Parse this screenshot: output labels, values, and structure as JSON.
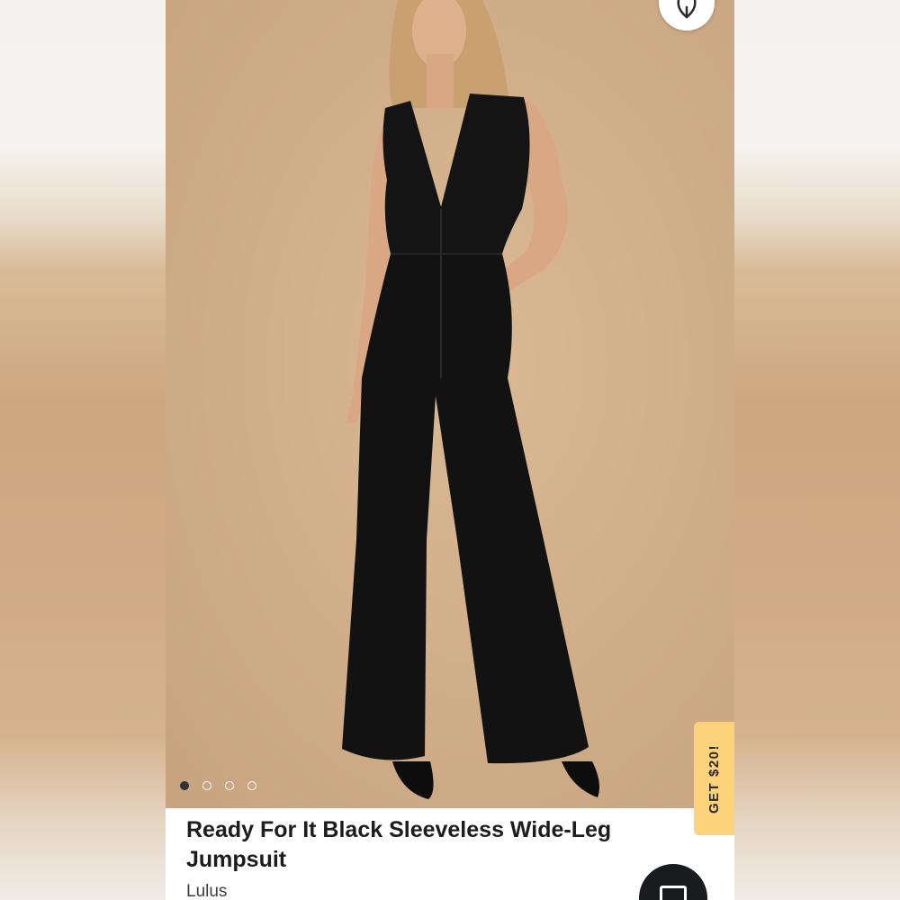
{
  "listing": {
    "title": "Ready For It Black Sleeveless Wide-Leg Jumpsuit",
    "brand": "Lulus"
  },
  "gallery": {
    "image_count": 4,
    "active_index": 0,
    "image_subject": "model wearing black sleeveless wide-leg jumpsuit on tan backdrop"
  },
  "promo": {
    "label": "GET $20!"
  },
  "icons": {
    "like": "heart-icon",
    "fab": "message-icon"
  },
  "colors": {
    "backdrop": "#cfad88",
    "promo": "#fcd27a",
    "fab": "#1a1b1f",
    "active_dot": "#2f3236"
  }
}
